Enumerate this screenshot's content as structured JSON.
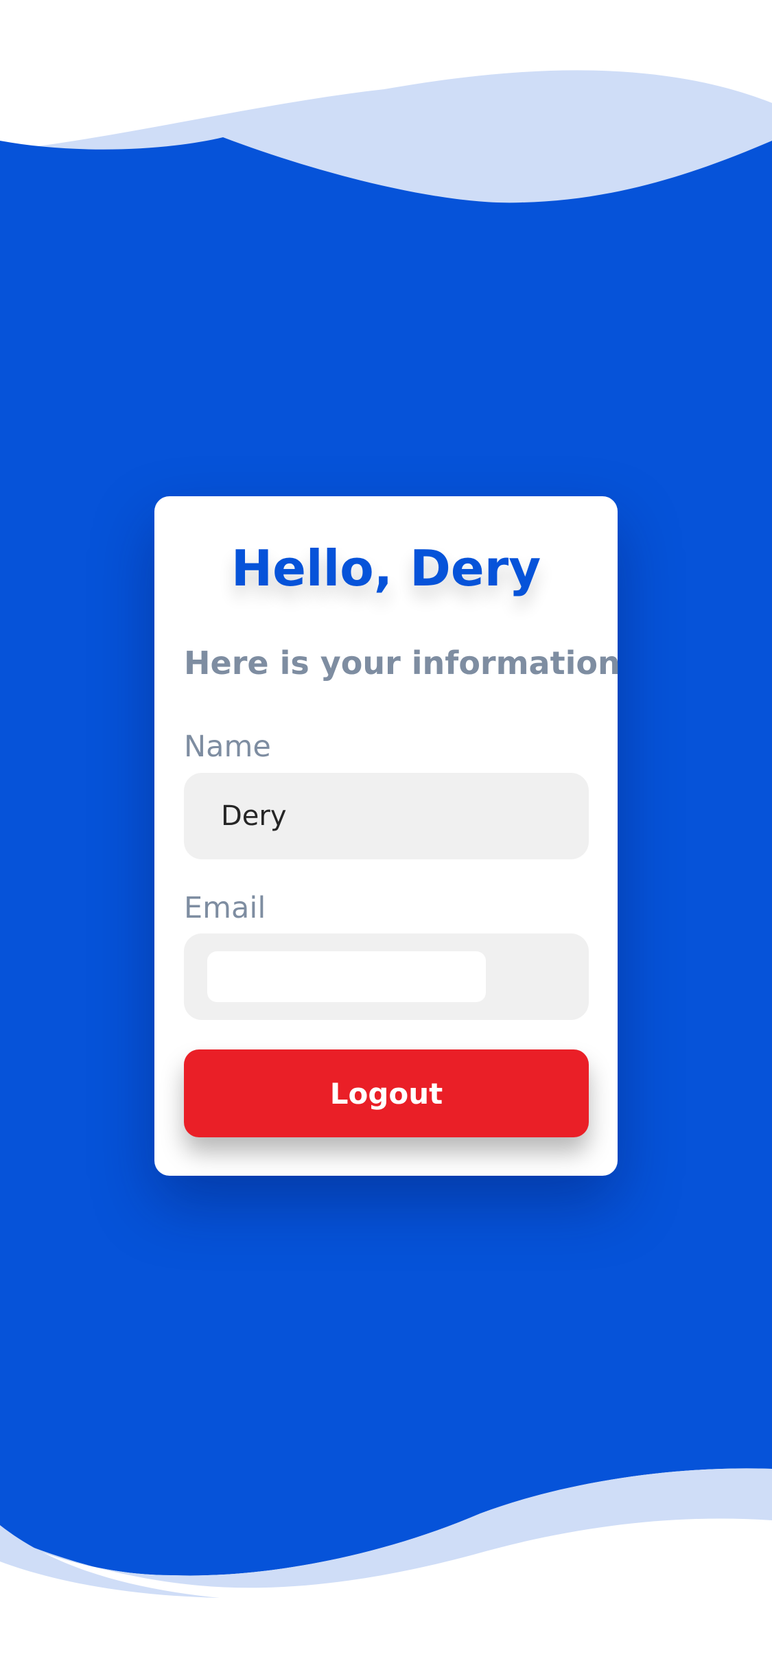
{
  "theme": {
    "background": "#0653d9",
    "wave_light": "#cfddf7",
    "page_white": "#ffffff",
    "accent_blue": "#0653d9",
    "muted_text": "#7e8da1",
    "field_fill": "#f0f0f0",
    "danger": "#ea1f27"
  },
  "card": {
    "greeting": "Hello, Dery",
    "info_heading": "Here is your information"
  },
  "fields": {
    "name": {
      "label": "Name",
      "value": "Dery"
    },
    "email": {
      "label": "Email",
      "value": ""
    }
  },
  "actions": {
    "logout_label": "Logout"
  }
}
